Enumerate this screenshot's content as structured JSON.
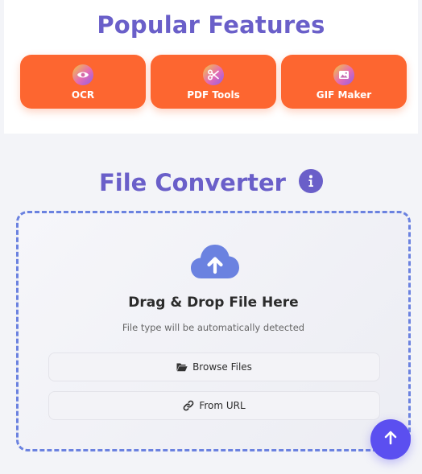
{
  "popular_features": {
    "title": "Popular Features",
    "items": [
      {
        "label": "OCR",
        "icon": "eye-icon"
      },
      {
        "label": "PDF Tools",
        "icon": "scissors-icon"
      },
      {
        "label": "GIF Maker",
        "icon": "image-icon"
      }
    ]
  },
  "file_converter": {
    "title": "File Converter",
    "info_icon": "info-icon",
    "drop_title": "Drag & Drop File Here",
    "drop_subtitle": "File type will be automatically detected",
    "browse_label": "Browse Files",
    "url_label": "From URL"
  },
  "colors": {
    "accent_purple": "#6a5fc9",
    "card_orange": "#fd6630",
    "dropzone_border": "#6b82e0",
    "scroll_button": "#5b4ff0"
  },
  "scroll_top_icon": "arrow-up-icon"
}
